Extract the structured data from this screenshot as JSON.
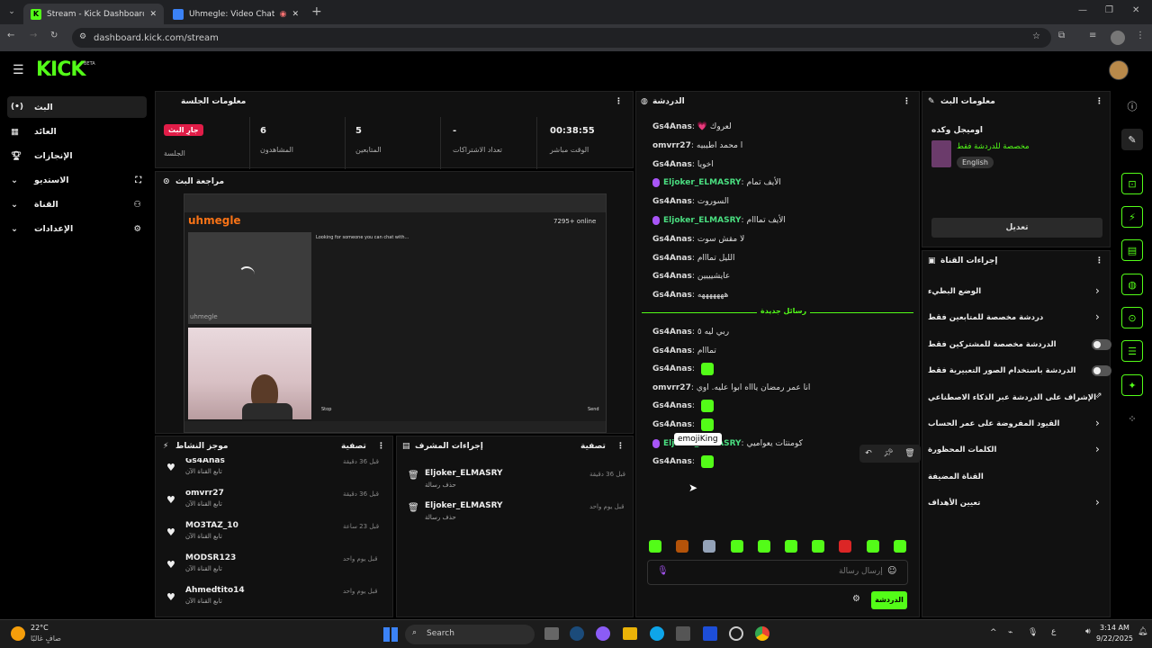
{
  "browser": {
    "tabs": [
      {
        "label": "Stream - Kick Dashboard"
      },
      {
        "label": "Uhmegle: Video Chat | Ome"
      }
    ],
    "url": "dashboard.kick.com/stream"
  },
  "kick": {
    "logo": "KICK",
    "beta": "BETA"
  },
  "sidebar": {
    "items": [
      {
        "label": "البث"
      },
      {
        "label": "العائد"
      },
      {
        "label": "الإنجازات"
      },
      {
        "label": "الاستديو"
      },
      {
        "label": "القناة"
      },
      {
        "label": "الإعدادات"
      }
    ]
  },
  "session": {
    "title": "معلومات الجلسة",
    "live_badge": "جارِ البث",
    "session_label": "الجلسة",
    "stats": [
      {
        "value": "6",
        "label": "المشاهدون"
      },
      {
        "value": "5",
        "label": "المتابعين"
      },
      {
        "value": "-",
        "label": "تعداد الاشتراكات"
      },
      {
        "value": "00:38:55",
        "label": "الوقت مباشر"
      }
    ]
  },
  "preview": {
    "title": "مراجعة البث",
    "site": "uhmegle",
    "online": "7295+ online",
    "prompt": "Looking for someone you can chat with...",
    "cam_label": "uhmegle",
    "stop": "Stop",
    "send": "Send"
  },
  "activity": {
    "title": "موجز النشاط",
    "filter": "تصفية",
    "items": [
      {
        "user": "Gs4Anas",
        "time": "قبل 36 دقيقة",
        "desc": "تابع القناة الآن"
      },
      {
        "user": "omvrr27",
        "time": "قبل 36 دقيقة",
        "desc": "تابع القناة الآن"
      },
      {
        "user": "MO3TAZ_10",
        "time": "قبل 23 ساعة",
        "desc": "تابع القناة الآن"
      },
      {
        "user": "MODSR123",
        "time": "قبل يوم واحد",
        "desc": "تابع القناة الآن"
      },
      {
        "user": "Ahmedtito14",
        "time": "قبل يوم واحد",
        "desc": "تابع القناة الآن"
      }
    ]
  },
  "mod": {
    "title": "إجراءات المشرف",
    "filter": "تصفية",
    "items": [
      {
        "user": "Eljoker_ELMASRY",
        "time": "قبل 36 دقيقة",
        "desc": "حذف رسالة"
      },
      {
        "user": "Eljoker_ELMASRY",
        "time": "قبل يوم واحد",
        "desc": "حذف رسالة"
      }
    ]
  },
  "chat": {
    "title": "الدردشة",
    "messages": [
      {
        "user": "Gs4Anas",
        "text": "لعروك 💗",
        "mod": false
      },
      {
        "user": "omvrr27",
        "text": "ا محمد اطيبيه",
        "mod": false
      },
      {
        "user": "Gs4Anas",
        "text": "اخويا",
        "mod": false
      },
      {
        "user": "Eljoker_ELMASRY",
        "text": "الأيف تمام",
        "mod": true
      },
      {
        "user": "Gs4Anas",
        "text": "السوروت",
        "mod": false
      },
      {
        "user": "Eljoker_ELMASRY",
        "text": "الأيف تمااام",
        "mod": true
      },
      {
        "user": "Gs4Anas",
        "text": "لا مقش سوت",
        "mod": false
      },
      {
        "user": "Gs4Anas",
        "text": "الليل تمااام",
        "mod": false
      },
      {
        "user": "Gs4Anas",
        "text": "عايشيييين",
        "mod": false
      },
      {
        "user": "Gs4Anas",
        "text": "هههههههه",
        "mod": false
      }
    ],
    "new_divider": "رسائل جديدة",
    "messages2": [
      {
        "user": "Gs4Anas",
        "text": "ربي ليه ٥",
        "mod": false
      },
      {
        "user": "Gs4Anas",
        "text": "تمااام",
        "mod": false
      },
      {
        "user": "Gs4Anas",
        "text": "",
        "mod": false
      },
      {
        "user": "omvrr27",
        "text": "انا عمر رمضان ياااه ابوا عليه. اوي",
        "mod": false
      },
      {
        "user": "Gs4Anas",
        "text": "",
        "mod": false
      },
      {
        "user": "Gs4Anas",
        "text": "",
        "mod": false
      },
      {
        "user": "Eljoker_ELMASRY",
        "text": "كومنتات يعواميي",
        "mod": true
      },
      {
        "user": "Gs4Anas",
        "text": "",
        "mod": false
      }
    ],
    "tooltip": "emojiKing",
    "placeholder": "إرسال رسالة",
    "send": "الدردشة"
  },
  "streaminfo": {
    "title": "معلومات البث",
    "stream_title": "اوميجل وكده",
    "category": "مخصصة للدردشة فقط",
    "lang": "English",
    "edit": "تعديل"
  },
  "channel": {
    "title": "إجراءات القناة",
    "rows": [
      {
        "label": "الوضع البطيء",
        "kind": "arrow"
      },
      {
        "label": "دردشة مخصصة للمتابعين فقط",
        "kind": "arrow"
      },
      {
        "label": "الدردشة مخصصة للمشتركين فقط",
        "kind": "toggle"
      },
      {
        "label": "الدردشة باستخدام الصور التعبيرية فقط",
        "kind": "toggle"
      },
      {
        "label": "الإشراف على الدردشة عبر الذكاء الاصطناعي",
        "kind": "ext"
      },
      {
        "label": "القيود المفروضة على عمر الحساب",
        "kind": "arrow"
      },
      {
        "label": "الكلمات المحظورة",
        "kind": "arrow"
      },
      {
        "label": "القناة المضيفة",
        "kind": "none"
      },
      {
        "label": "تعيين الأهداف",
        "kind": "arrow"
      }
    ]
  },
  "taskbar": {
    "weather_temp": "22°C",
    "weather_desc": "صافٍ غالبًا",
    "search": "Search",
    "time": "3:14 AM",
    "date": "9/22/2025",
    "lang": "ع"
  },
  "colors": {
    "accent": "#53fc18",
    "live": "#e11d48"
  }
}
